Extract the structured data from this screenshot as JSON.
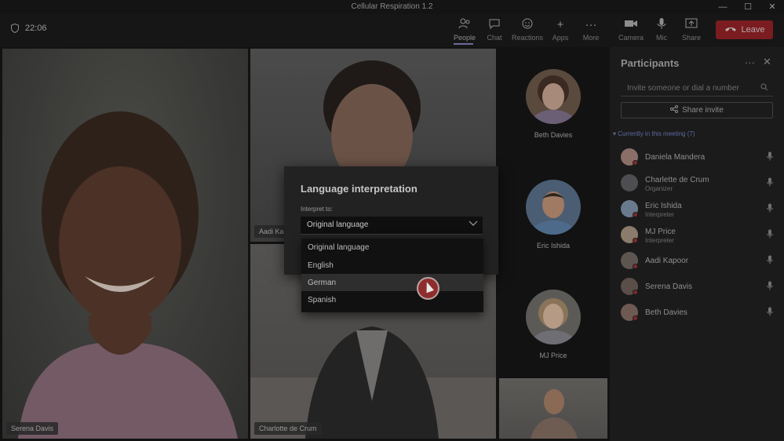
{
  "window": {
    "title": "Cellular Respiration 1.2",
    "controls": [
      "—",
      "☐",
      "✕"
    ]
  },
  "toolbar": {
    "timer": "22:06",
    "buttons": [
      {
        "label": "People",
        "icon": "people-icon"
      },
      {
        "label": "Chat",
        "icon": "chat-icon"
      },
      {
        "label": "Reactions",
        "icon": "reactions-icon"
      },
      {
        "label": "Apps",
        "icon": "apps-icon"
      },
      {
        "label": "More",
        "icon": "more-icon"
      },
      {
        "label": "Camera",
        "icon": "camera-icon"
      },
      {
        "label": "Mic",
        "icon": "mic-icon"
      },
      {
        "label": "Share",
        "icon": "share-icon"
      }
    ],
    "leave_label": "Leave"
  },
  "stage": {
    "tiles": [
      {
        "name": "Serena Davis"
      },
      {
        "name": "Aadi Kapoor",
        "name_visible": "Aadi Kap"
      },
      {
        "name": "Charlotte de Crum"
      }
    ],
    "thumbnails": [
      {
        "name": "Beth Davies"
      },
      {
        "name": "Eric Ishida"
      },
      {
        "name": "MJ Price"
      }
    ]
  },
  "participants_panel": {
    "title": "Participants",
    "invite_placeholder": "Invite someone or dial a number",
    "share_invite_label": "Share invite",
    "section_label": "Currently in this meeting (7)",
    "participants": [
      {
        "name": "Daniela Mandera",
        "role": ""
      },
      {
        "name": "Charlette de Crum",
        "role": "Organizer"
      },
      {
        "name": "Eric Ishida",
        "role": "Interpreter"
      },
      {
        "name": "MJ Price",
        "role": "Interpreter"
      },
      {
        "name": "Aadi Kapoor",
        "role": ""
      },
      {
        "name": "Serena Davis",
        "role": ""
      },
      {
        "name": "Beth Davies",
        "role": ""
      }
    ]
  },
  "dialog": {
    "title": "Language interpretation",
    "interpret_label": "Interpret to:",
    "selected": "Original language",
    "options": [
      "Original language",
      "English",
      "German",
      "Spanish"
    ],
    "hovered_option": "German"
  }
}
